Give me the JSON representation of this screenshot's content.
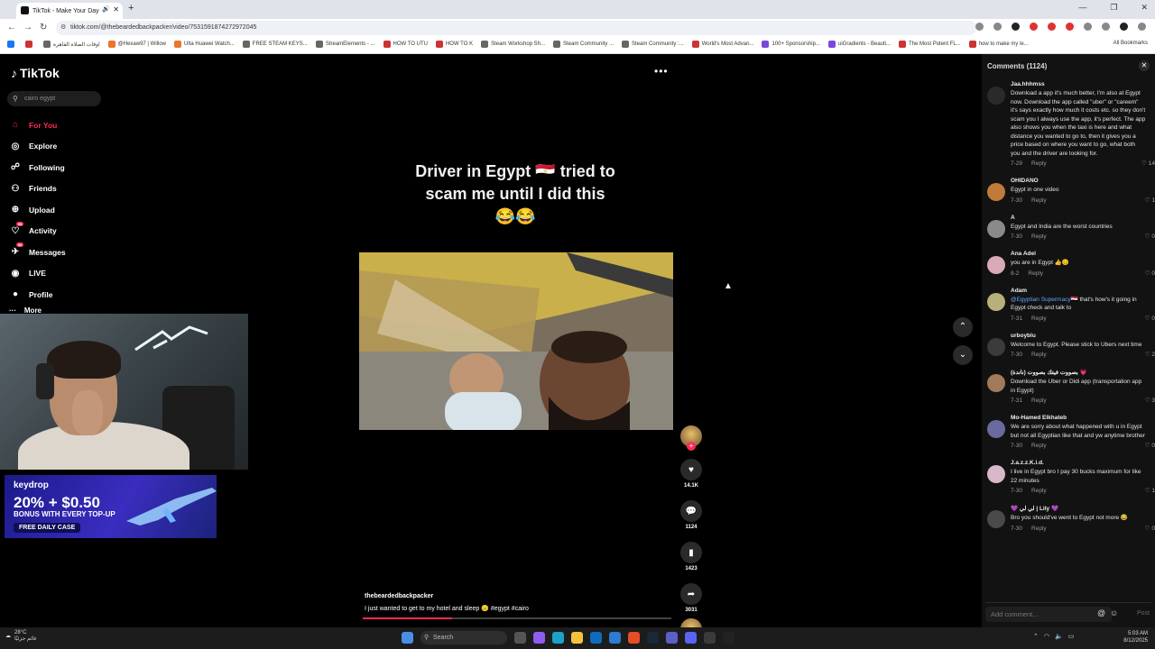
{
  "browser": {
    "tab_title": "TikTok - Make Your Day",
    "new_tab": "+",
    "url": "tiktok.com/@thebeardedbackpacker/video/7531591874272972045",
    "window_controls": [
      "—",
      "❐",
      "✕"
    ],
    "bookmarks": [
      {
        "label": "",
        "icon": "facebook-icon"
      },
      {
        "label": "",
        "icon": "youtube-icon"
      },
      {
        "label": "اوقات الصلاة القاهرة",
        "icon": "prayer-icon"
      },
      {
        "label": "@Hexaw97 | Willow",
        "icon": "willow-icon"
      },
      {
        "label": "Ulta Huawei Watch...",
        "icon": "huawei-icon"
      },
      {
        "label": "FREE STEAM KEYS...",
        "icon": "steam-icon"
      },
      {
        "label": "StreamElements - ...",
        "icon": "streamelements-icon"
      },
      {
        "label": "HOW TO UTU",
        "icon": "youtube-icon"
      },
      {
        "label": "HOW TO K",
        "icon": "youtube-icon"
      },
      {
        "label": "Steam Workshop Sh...",
        "icon": "steam-icon"
      },
      {
        "label": "Steam Community ...",
        "icon": "steam-icon"
      },
      {
        "label": "Steam Community :...",
        "icon": "steam-icon"
      },
      {
        "label": "World's Most Advan...",
        "icon": "youtube-icon"
      },
      {
        "label": "100+ Sponsorship...",
        "icon": "pin-icon"
      },
      {
        "label": "uiGradients - Beauti...",
        "icon": "gradient-icon"
      },
      {
        "label": "The Most Potent FL...",
        "icon": "youtube-icon"
      },
      {
        "label": "how to make my le...",
        "icon": "youtube-icon"
      }
    ],
    "all_bookmarks": "All Bookmarks"
  },
  "sidebar": {
    "logo": "TikTok",
    "search_placeholder": "cairo egypt",
    "items": [
      {
        "label": "For You",
        "icon": "home-icon",
        "active": true
      },
      {
        "label": "Explore",
        "icon": "compass-icon"
      },
      {
        "label": "Following",
        "icon": "following-icon"
      },
      {
        "label": "Friends",
        "icon": "friends-icon"
      },
      {
        "label": "Upload",
        "icon": "upload-icon"
      },
      {
        "label": "Activity",
        "icon": "activity-icon",
        "badge": "99"
      },
      {
        "label": "Messages",
        "icon": "messages-icon",
        "badge": "86"
      },
      {
        "label": "LIVE",
        "icon": "live-icon"
      },
      {
        "label": "Profile",
        "icon": "profile-icon"
      }
    ],
    "more": "More"
  },
  "overlay": {
    "promo_brand": "keydrop",
    "promo_headline": "20% + $0.50",
    "promo_sub": "BONUS WITH EVERY TOP-UP",
    "promo_cta": "FREE DAILY CASE"
  },
  "video": {
    "menu": "•••",
    "caption_line1": "Driver in Egypt 🇪🇬 tried to",
    "caption_line2": "scam me until I did this",
    "caption_line3": "😂😂",
    "username": "thebeardedbackpacker",
    "description": "I just wanted to get to my hotel and sleep 😑 #egypt #cairo",
    "progress": 0.29,
    "likes": "14.1K",
    "comments": "1124",
    "saves": "1423",
    "shares": "3031"
  },
  "comments_panel": {
    "title": "Comments (1124)",
    "close": "✕",
    "input_placeholder": "Add comment...",
    "post": "Post",
    "comments": [
      {
        "user": "Jaa.hhhmss",
        "text": "Download a app it's much better, I'm also at Egypt now. Download the app called \"uber\" or \"careem\" it's says exactly how much it costs etc. so they don't scam you I always use the app, it's perfect. The app also shows you when the taxi is here and what distance you wanted to go to, then it gives you a price based on where you want to go, what both you and the driver are looking for.",
        "date": "7-29",
        "likes": "14"
      },
      {
        "user": "OHIDANO",
        "text": "Egypt in one video",
        "date": "7-30",
        "likes": "1"
      },
      {
        "user": "A",
        "text": "Egypt and India are the worst countries",
        "date": "7-30",
        "likes": "0"
      },
      {
        "user": "Ana Adel",
        "text": "you are in Egypt 👍😊",
        "date": "8-2",
        "likes": "0"
      },
      {
        "user": "Adam",
        "mention": "@Egyptian Supermacy🇪🇬",
        "text": " that's how's it going in Egypt check and talk to",
        "date": "7-31",
        "likes": "0"
      },
      {
        "user": "urboyblu",
        "text": "Welcome to Egypt. Please stick to Ubers next time",
        "date": "7-30",
        "likes": "2"
      },
      {
        "user": "بصووت فيتك بصووت (ناندة) 💗",
        "text": "Download the Uber or Didi app (transportation app in Egypt)",
        "date": "7-31",
        "likes": "3"
      },
      {
        "user": "Mo-Hamed Elkhateb",
        "text": "We are sorry about what happened with u in Egypt but not all Egyptian like that and yw anytime brother",
        "date": "7-30",
        "likes": "0"
      },
      {
        "user": "J.a.z.z.K.i.d.",
        "text": "I live in Egypt bro I pay 30 bucks maximum for like 22 minutes",
        "date": "7-30",
        "likes": "1"
      },
      {
        "user": "💜 لي لي | Lily 💜",
        "text": "Bro you should've went to Egypt not more 😂",
        "date": "7-30",
        "likes": "0"
      }
    ],
    "reply_label": "Reply"
  },
  "taskbar": {
    "weather_temp": "28°C",
    "weather_desc": "غائم جزئيًا",
    "search": "Search",
    "time": "5:03 AM",
    "date": "8/12/2025"
  }
}
